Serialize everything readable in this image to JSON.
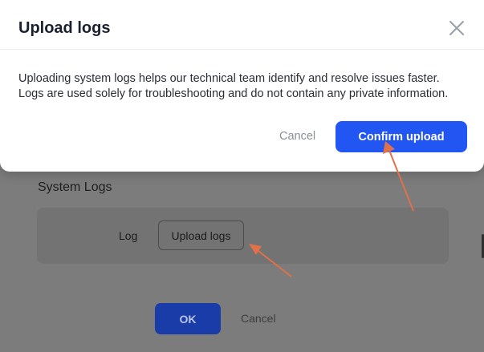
{
  "dialog": {
    "title": "Upload logs",
    "message_line1": "Uploading system logs helps our technical team identify and resolve issues faster.",
    "message_line2": "Logs are used solely for troubleshooting and do not contain any private information.",
    "cancel_label": "Cancel",
    "confirm_label": "Confirm upload",
    "close_icon": "close-icon"
  },
  "background": {
    "section_title": "System Logs",
    "log_label": "Log",
    "upload_button_label": "Upload logs",
    "ok_label": "OK",
    "cancel_label": "Cancel"
  },
  "colors": {
    "primary": "#2156f3",
    "annotation_arrow": "#e0714a",
    "overlay": "#7c7c7c"
  }
}
